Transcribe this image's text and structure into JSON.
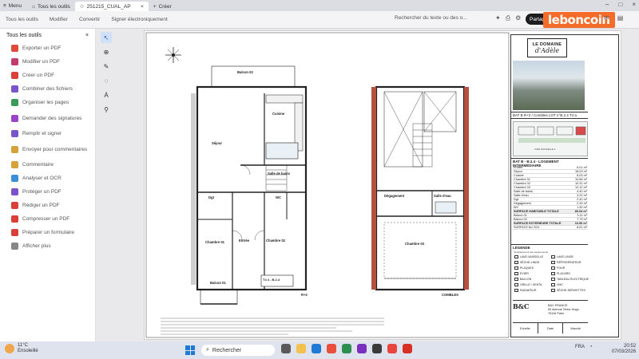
{
  "tabstrip": {
    "menu_label": "Menu",
    "tabs": [
      {
        "label": "Tous les outils"
      },
      {
        "label": "251215_CUAL_AP"
      },
      {
        "label": "Créer"
      }
    ]
  },
  "toolbar": {
    "items": [
      "Tous les outils",
      "Modifier",
      "Convertir",
      "Signer électroniquement"
    ],
    "search_label": "Rechercher du texte ou des o...",
    "share_label": "Partager",
    "brand": "leboncoin"
  },
  "leftpanel": {
    "title": "Tous les outils",
    "tools": [
      {
        "label": "Exporter un PDF",
        "color": "#e04a3a"
      },
      {
        "label": "Modifier un PDF",
        "color": "#c43b6e"
      },
      {
        "label": "Créer un PDF",
        "color": "#d9403a"
      },
      {
        "label": "Combiner des fichiers",
        "color": "#7a55c9"
      },
      {
        "label": "Organiser les pages",
        "color": "#3a9a5a"
      },
      {
        "label": "Demander des signatures",
        "color": "#9a44c9"
      },
      {
        "label": "Remplir et signer",
        "color": "#7a55c9"
      },
      {
        "label": "Envoyer pour commentaires",
        "color": "#d6a23a"
      },
      {
        "label": "Commentaire",
        "color": "#d6a23a"
      },
      {
        "label": "Analyser et OCR",
        "color": "#3a8fd6"
      },
      {
        "label": "Protéger un PDF",
        "color": "#7a55c9"
      },
      {
        "label": "Rédiger un PDF",
        "color": "#d9403a"
      },
      {
        "label": "Compresser un PDF",
        "color": "#d9403a"
      },
      {
        "label": "Préparer un formulaire",
        "color": "#d9403a"
      },
      {
        "label": "Afficher plus",
        "color": "#888888"
      }
    ]
  },
  "plan": {
    "rooms_lower": [
      {
        "name": "Balcon 02"
      },
      {
        "name": "Séjour"
      },
      {
        "name": "Cuisine"
      },
      {
        "name": "Salle de bains"
      },
      {
        "name": "Dgt"
      },
      {
        "name": "WC"
      },
      {
        "name": "Chambre 01"
      },
      {
        "name": "Entrée"
      },
      {
        "name": "Chambre 02"
      },
      {
        "name": "Balcon 01"
      }
    ],
    "rooms_upper": [
      {
        "name": "Dégagement"
      },
      {
        "name": "Salle d'eau"
      },
      {
        "name": "Chambre 03"
      }
    ],
    "lot_label": "T4 4 - B.2.4",
    "level_left": "R+2",
    "level_right": "COMBLES"
  },
  "titleblock": {
    "domaine_top": "LE DOMAINE",
    "domaine_name": "d'Adèle",
    "bat_line": "BAT B  R+2 / Combles  LOT n°B.2.4  T4 a",
    "keyplan_caption": "VOIE NOUVELLE 1",
    "section_title": "BAT B - B.2.4 - LOGEMENT INTERMÉDIAIRE",
    "surfaces": [
      {
        "k": "Entrée",
        "v": "6.01 m²"
      },
      {
        "k": "Séjour",
        "v": "18.03 m²"
      },
      {
        "k": "Cuisine",
        "v": "8.03 m²"
      },
      {
        "k": "Chambre 01",
        "v": "10.66 m²"
      },
      {
        "k": "Chambre 02",
        "v": "10.31 m²"
      },
      {
        "k": "Chambre 03",
        "v": "12.12 m²"
      },
      {
        "k": "Salle de bains",
        "v": "4.40 m²"
      },
      {
        "k": "Salle d'eau",
        "v": "3.22 m²"
      },
      {
        "k": "Dgt",
        "v": "2.42 m²"
      },
      {
        "k": "Dégagement",
        "v": "2.33 m²"
      },
      {
        "k": "WC",
        "v": "1.30 m²"
      }
    ],
    "surface_totale": {
      "k": "SURFACE HABITABLE TOTALE",
      "v": "80.04 m²"
    },
    "balcons": [
      {
        "k": "Balcon 01",
        "v": "3.11 m²"
      },
      {
        "k": "Balcon 02",
        "v": "7.79 m²"
      }
    ],
    "surface_ext": {
      "k": "SURFACE EXTERIEURE TOTALE",
      "v": "10.90 m²"
    },
    "surface_sol": {
      "k": "SURFACE AU SOL",
      "v": "8.51 m²"
    },
    "legende_title": "LÉGENDE",
    "legende_note": "Emplacement des équipements",
    "legende": [
      "LAVE-VAISSELLE",
      "LAVE-LINGE",
      "SÈCHE-LINGE",
      "RÉFRIGÉRATEUR",
      "PLAQUES",
      "FOUR",
      "EVIER",
      "PLACARD",
      "BALLON",
      "TABLEAU ÉLECTRIQUE",
      "GRILLE / VENTIL",
      "VMC",
      "RADIATEUR",
      "SÈCHE-SERVIETTES"
    ],
    "company": "B&C FRANCE",
    "address1": "50 Avenue Victor Hugo",
    "address2": "75116 Paris",
    "footer": [
      "Echelle",
      "Date",
      "Marché"
    ]
  },
  "taskbar": {
    "weather_temp": "11°C",
    "weather_desc": "Ensoleillé",
    "search_label": "Rechercher",
    "lang": "FRA",
    "time": "20:52",
    "date": "07/03/2026"
  }
}
